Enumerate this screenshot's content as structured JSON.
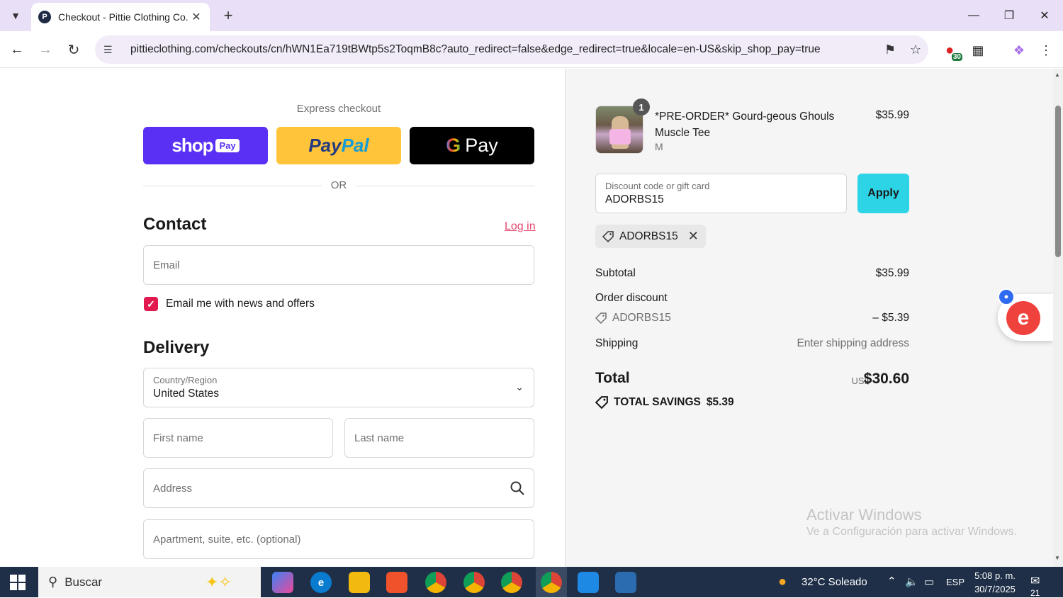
{
  "browser": {
    "tab_title": "Checkout - Pittie Clothing Co.",
    "favicon_letter": "P",
    "url": "pittieclothing.com/checkouts/cn/hWN1Ea719tBWtp5s2ToqmB8c?auto_redirect=false&edge_redirect=true&locale=en-US&skip_shop_pay=true",
    "extension_badge": "30"
  },
  "express": {
    "label": "Express checkout",
    "shop_text": "shop",
    "shop_pay": "Pay",
    "paypal_a": "Pay",
    "paypal_b": "Pal",
    "gpay_g": "G",
    "gpay_text": "Pay",
    "or": "OR"
  },
  "contact": {
    "heading": "Contact",
    "login": "Log in",
    "email_placeholder": "Email",
    "newsletter_label": "Email me with news and offers"
  },
  "delivery": {
    "heading": "Delivery",
    "country_label": "Country/Region",
    "country_value": "United States",
    "first_name": "First name",
    "last_name": "Last name",
    "address": "Address",
    "apartment": "Apartment, suite, etc. (optional)"
  },
  "order": {
    "quantity": "1",
    "product_name": "*PRE-ORDER* Gourd-geous Ghouls Muscle Tee",
    "variant": "M",
    "price": "$35.99",
    "discount_label": "Discount code or gift card",
    "discount_value": "ADORBS15",
    "apply": "Apply",
    "applied_code": "ADORBS15",
    "subtotal_label": "Subtotal",
    "subtotal_value": "$35.99",
    "order_discount_label": "Order discount",
    "order_discount_code": "ADORBS15",
    "order_discount_value": "– $5.39",
    "shipping_label": "Shipping",
    "shipping_value": "Enter shipping address",
    "total_label": "Total",
    "total_currency": "USD",
    "total_value": "$30.60",
    "savings_label": "TOTAL SAVINGS",
    "savings_value": "$5.39"
  },
  "watermark": {
    "line1": "Activar Windows",
    "line2": "Ve a Configuración para activar Windows."
  },
  "taskbar": {
    "search": "Buscar",
    "weather": "32°C  Soleado",
    "language": "ESP",
    "time": "5:08 p. m.",
    "date": "30/7/2025",
    "notifications": "21"
  },
  "colors": {
    "accent_pink": "#e1194f",
    "apply_cyan": "#2dd4e6",
    "shop_purple": "#5a31f4",
    "paypal_yellow": "#ffc439"
  }
}
